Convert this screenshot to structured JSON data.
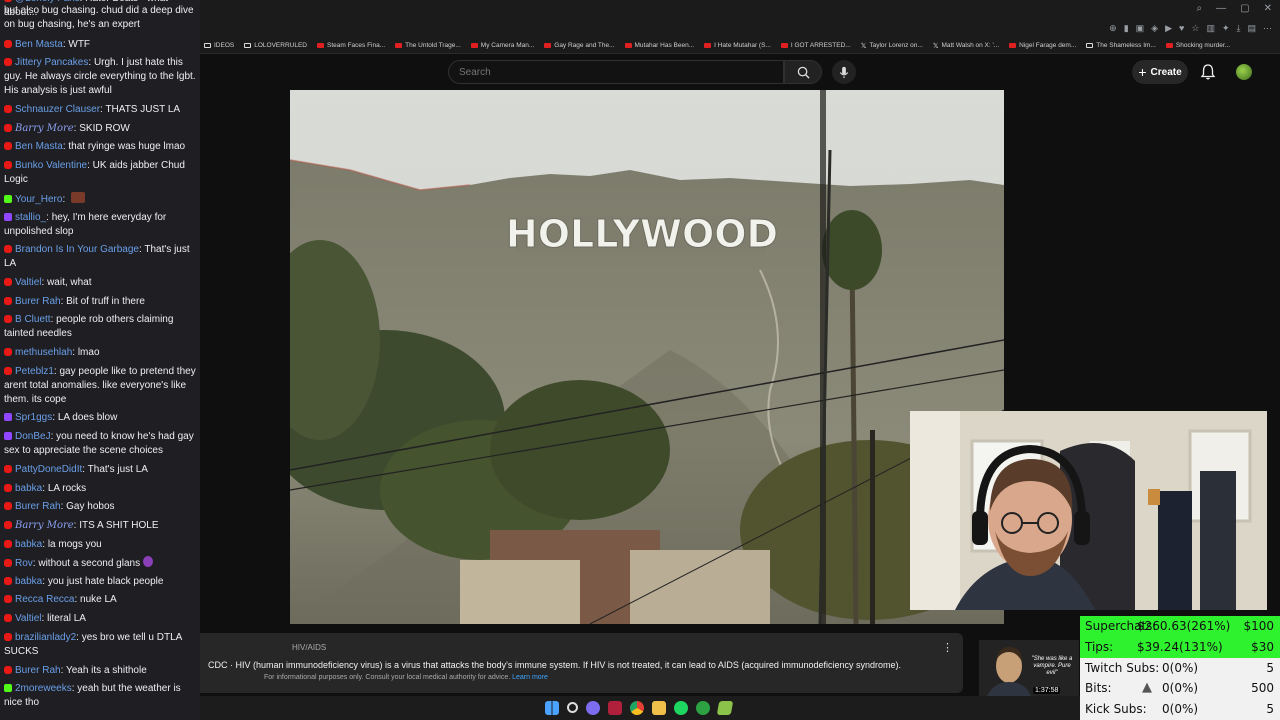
{
  "bookmarks": [
    {
      "label": "IDEOS",
      "icon": "folder"
    },
    {
      "label": "LOLOVERRULED",
      "icon": "folder"
    },
    {
      "label": "Steam Faces Fina...",
      "icon": "youtube"
    },
    {
      "label": "The Untold Trage...",
      "icon": "youtube"
    },
    {
      "label": "My Camera Man...",
      "icon": "youtube"
    },
    {
      "label": "Gay Rage and The...",
      "icon": "youtube"
    },
    {
      "label": "Mutahar Has Been...",
      "icon": "youtube"
    },
    {
      "label": "I Hate Mutahar (S...",
      "icon": "youtube"
    },
    {
      "label": "I GOT ARRESTED...",
      "icon": "youtube"
    },
    {
      "label": "Taylor Lorenz on...",
      "icon": "x"
    },
    {
      "label": "Matt Walsh on X: '...",
      "icon": "x"
    },
    {
      "label": "Nigel Farage dem...",
      "icon": "youtube"
    },
    {
      "label": "The Shameless Im...",
      "icon": "folder"
    },
    {
      "label": "Shocking murder...",
      "icon": "youtube"
    }
  ],
  "header": {
    "search_placeholder": "Search",
    "create_label": "Create"
  },
  "video": {
    "sign_text": "HOLLYWOOD"
  },
  "info_bar": {
    "title": "HIV/AIDS",
    "text": "CDC · HIV (human immunodeficiency virus) is a virus that attacks the body's immune system. If HIV is not treated, it can lead to AIDS (acquired immunodeficiency syndrome).",
    "small": "For informational purposes only. Consult your local medical authority for advice.",
    "learn_more": "Learn more"
  },
  "thumbnail": {
    "quote": "\"She was like a vampire. Pure evil\"",
    "duration": "1:37:58"
  },
  "donations": [
    {
      "label": "Superchats:",
      "amount": "$260.63(261%)",
      "goal": "$100",
      "color": "#2ff22f"
    },
    {
      "label": "Tips:",
      "amount": "$39.24(131%)",
      "goal": "$30",
      "color": "#2ff22f"
    },
    {
      "label": "Twitch Subs:",
      "amount": "0(0%)",
      "goal": "5",
      "color": "#f1f1f1"
    },
    {
      "label": "Bits:",
      "amount": "0(0%)",
      "goal": "500",
      "color": "#f1f1f1"
    },
    {
      "label": "Kick Subs:",
      "amount": "0(0%)",
      "goal": "5",
      "color": "#f1f1f1"
    }
  ],
  "chat": [
    {
      "platform": "youtube",
      "user": "@Lonely Fans",
      "text": "Hater Beats - what about...",
      "fancy": false
    },
    {
      "platform": "",
      "user": "",
      "text": "but also bug chasing. chud did a deep dive on bug chasing, he's an expert",
      "fancy": false
    },
    {
      "platform": "youtube",
      "user": "Ben Masta",
      "text": "WTF",
      "fancy": false
    },
    {
      "platform": "youtube",
      "user": "Jittery Pancakes",
      "text": "Urgh. I just hate this guy. He always circle everything to the lgbt. His analysis is just awful",
      "fancy": false
    },
    {
      "platform": "youtube",
      "user": "Schnauzer Clauser",
      "text": "THATS JUST LA",
      "fancy": false
    },
    {
      "platform": "youtube",
      "user": "Barry More",
      "text": "SKID ROW",
      "fancy": true
    },
    {
      "platform": "youtube",
      "user": "Ben Masta",
      "text": "that ryinge was huge lmao",
      "fancy": false
    },
    {
      "platform": "youtube",
      "user": "Bunko Valentine",
      "text": "UK aids jabber Chud Logic",
      "fancy": false
    },
    {
      "platform": "kick",
      "user": "Your_Hero",
      "text": "",
      "fancy": false,
      "emote": true
    },
    {
      "platform": "twitch",
      "user": "stallio_",
      "text": "hey, I'm here everyday for unpolished slop",
      "fancy": false
    },
    {
      "platform": "youtube",
      "user": "Brandon Is In Your Garbage",
      "text": "That's just LA",
      "fancy": false
    },
    {
      "platform": "youtube",
      "user": "Valtiel",
      "text": "wait, what",
      "fancy": false
    },
    {
      "platform": "youtube",
      "user": "Burer Rah",
      "text": "Bit of truff in there",
      "fancy": false
    },
    {
      "platform": "youtube",
      "user": "B Cluett",
      "text": "people rob others claiming tainted needles",
      "fancy": false
    },
    {
      "platform": "youtube",
      "user": "methusehlah",
      "text": "lmao",
      "fancy": false
    },
    {
      "platform": "youtube",
      "user": "Peteblz1",
      "text": "gay people like to pretend they arent total anomalies. like everyone's like them. its cope",
      "fancy": false
    },
    {
      "platform": "twitch",
      "user": "Spr1ggs",
      "text": "LA does blow",
      "fancy": false
    },
    {
      "platform": "twitch",
      "user": "DonBeJ",
      "text": "you need to know he's had gay sex to appreciate the scene choices",
      "fancy": false
    },
    {
      "platform": "youtube",
      "user": "PattyDoneDidIt",
      "text": "That's just LA",
      "fancy": false
    },
    {
      "platform": "youtube",
      "user": "babka",
      "text": "LA rocks",
      "fancy": false
    },
    {
      "platform": "youtube",
      "user": "Burer Rah",
      "text": "Gay hobos",
      "fancy": false
    },
    {
      "platform": "youtube",
      "user": "Barry More",
      "text": "ITS A SHIT HOLE",
      "fancy": true
    },
    {
      "platform": "youtube",
      "user": "babka",
      "text": "la mogs you",
      "fancy": false
    },
    {
      "platform": "youtube",
      "user": "Rov",
      "text": "without a second glans",
      "fancy": false,
      "eggplant": true
    },
    {
      "platform": "youtube",
      "user": "babka",
      "text": "you just hate black people",
      "fancy": false
    },
    {
      "platform": "youtube",
      "user": "Recca Recca",
      "text": "nuke LA",
      "fancy": false
    },
    {
      "platform": "youtube",
      "user": "Valtiel",
      "text": "literal LA",
      "fancy": false
    },
    {
      "platform": "youtube",
      "user": "brazilianlady2",
      "text": "yes bro we tell u DTLA SUCKS",
      "fancy": false
    },
    {
      "platform": "youtube",
      "user": "Burer Rah",
      "text": "Yeah its a shithole",
      "fancy": false
    },
    {
      "platform": "kick",
      "user": "2moreweeks",
      "text": "yeah but the weather is nice tho",
      "fancy": false
    }
  ]
}
